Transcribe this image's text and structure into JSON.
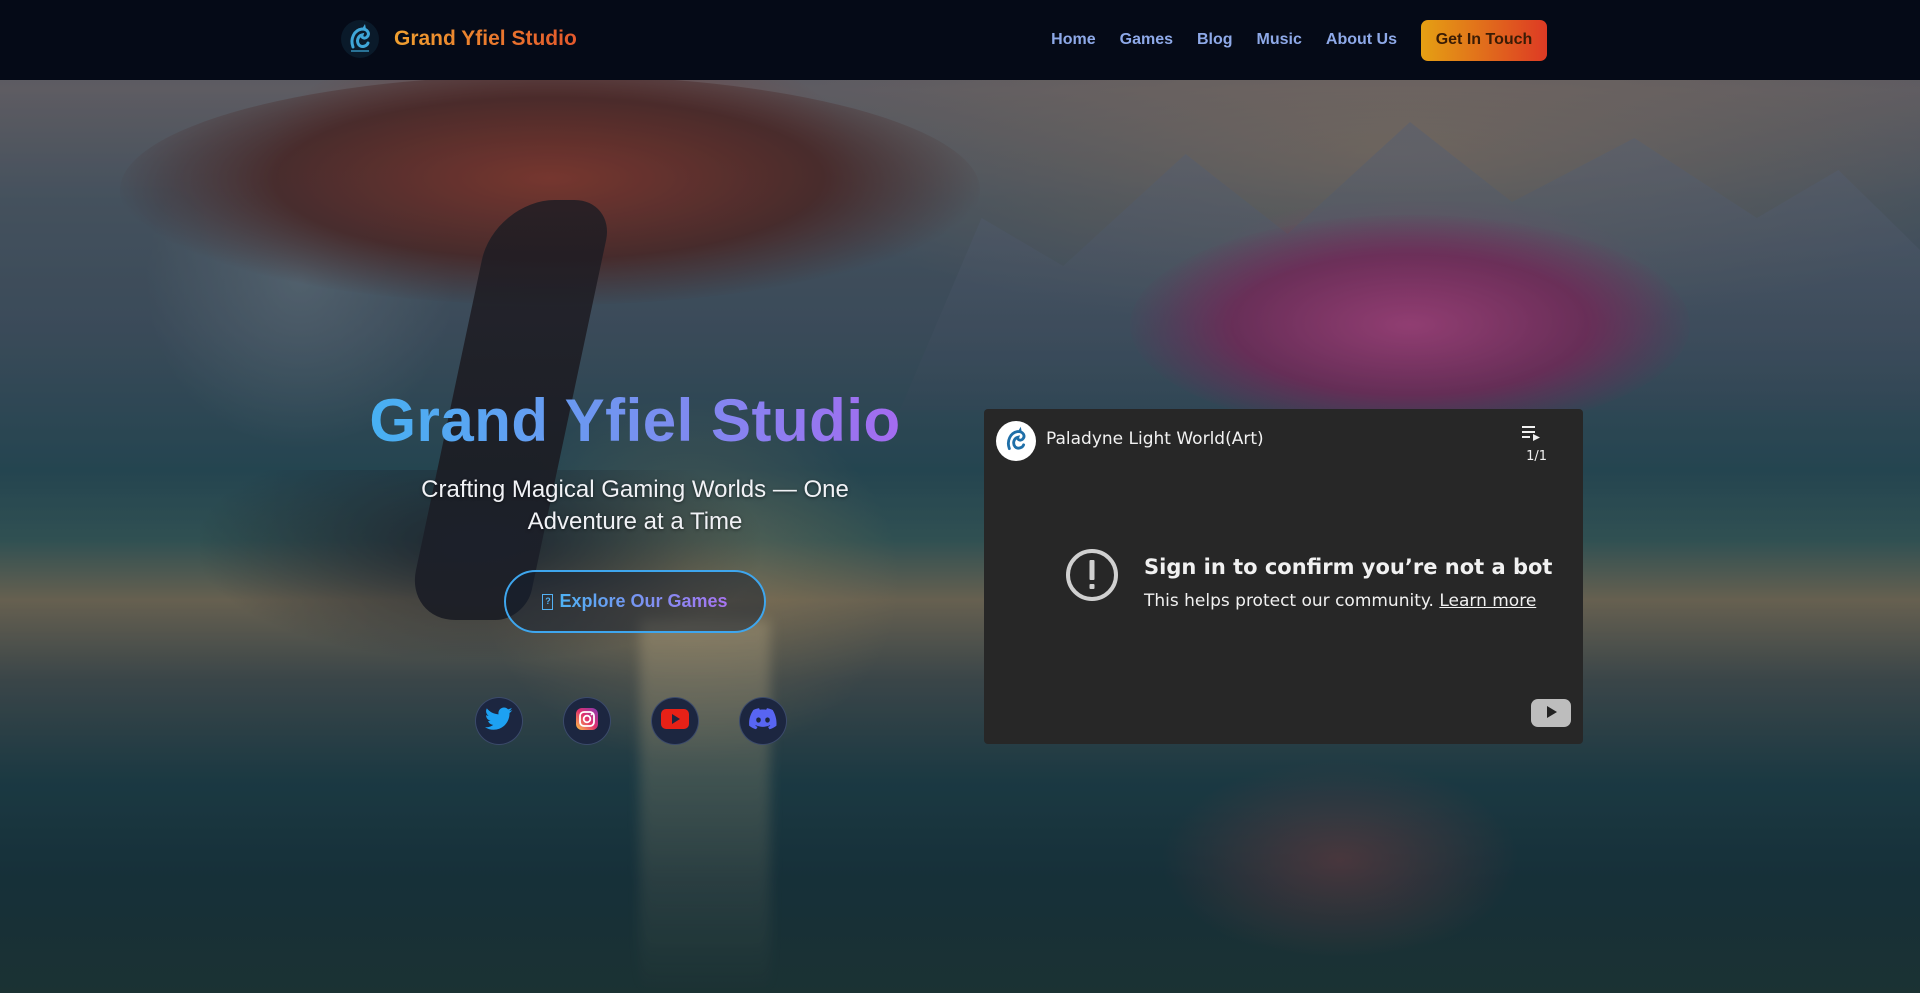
{
  "navbar": {
    "brand_name": "Grand Yfiel Studio",
    "logo_icon": "dragon-logo-icon",
    "links": [
      {
        "label": "Home"
      },
      {
        "label": "Games"
      },
      {
        "label": "Blog"
      },
      {
        "label": "Music"
      },
      {
        "label": "About Us"
      }
    ],
    "cta_label": "Get In Touch"
  },
  "hero": {
    "title": "Grand Yfiel Studio",
    "subtitle": "Crafting Magical Gaming Worlds — One Adventure at a Time",
    "explore_icon_glyph": "?",
    "explore_label": "Explore Our Games",
    "socials": [
      {
        "icon": "twitter-icon"
      },
      {
        "icon": "instagram-icon"
      },
      {
        "icon": "youtube-icon"
      },
      {
        "icon": "discord-icon"
      }
    ]
  },
  "video": {
    "title": "Paladyne Light World(Art)",
    "playlist_count": "1/1",
    "error_title": "Sign in to confirm you’re not a bot",
    "error_text": "This helps protect our community.",
    "error_link": "Learn more"
  },
  "colors": {
    "nav_background": "#050a17",
    "nav_link": "#8ea9e8",
    "cta_gradient_start": "#e5a013",
    "cta_gradient_end": "#dd3a24",
    "title_gradient_start": "#47b1f3",
    "title_gradient_end": "#a46bf0",
    "video_background": "#272727"
  }
}
